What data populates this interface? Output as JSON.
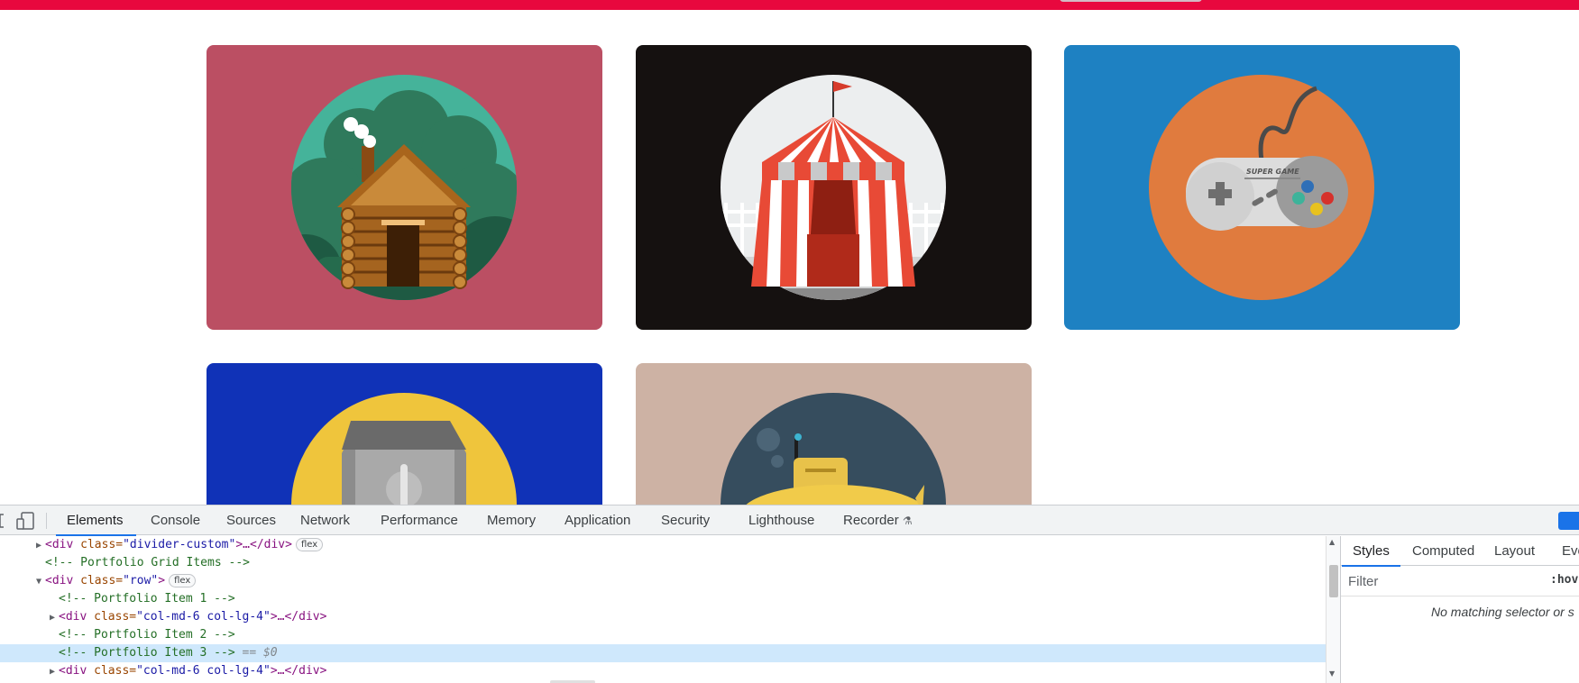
{
  "page": {
    "colors": {
      "topbar": "#e8083e",
      "card_cabin": "#bb4f63",
      "card_circus": "#151110",
      "card_game": "#1e81c2",
      "card_safe": "#1032b7",
      "card_submarine": "#cdb2a4"
    },
    "portfolio_items": [
      {
        "icon": "cabin-icon"
      },
      {
        "icon": "circus-tent-icon"
      },
      {
        "icon": "game-controller-icon",
        "controller_text": "SUPER GAME"
      },
      {
        "icon": "safe-icon"
      },
      {
        "icon": "submarine-icon"
      }
    ]
  },
  "devtools": {
    "tabs": [
      "Elements",
      "Console",
      "Sources",
      "Network",
      "Performance",
      "Memory",
      "Application",
      "Security",
      "Lighthouse",
      "Recorder"
    ],
    "active_tab": "Elements",
    "recorder_icon": "flask-icon",
    "dom_lines": [
      {
        "tag_open": "<div ",
        "attr": "class=",
        "val": "\"divider-custom\"",
        "rest": ">…</div>",
        "badge": "flex"
      },
      {
        "comment": "<!-- Portfolio Grid Items -->"
      },
      {
        "tag_open": "<div ",
        "attr": "class=",
        "val": "\"row\"",
        "rest": ">",
        "badge": "flex"
      },
      {
        "comment": "<!-- Portfolio Item 1 -->"
      },
      {
        "tag_open": "<div ",
        "attr": "class=",
        "val": "\"col-md-6 col-lg-4\"",
        "rest": ">…</div>"
      },
      {
        "comment": "<!-- Portfolio Item 2 -->"
      },
      {
        "comment": "<!-- Portfolio Item 3 -->",
        "marker": "== $0"
      },
      {
        "tag_open": "<div ",
        "attr": "class=",
        "val": "\"col-md-6 col-lg-4\"",
        "rest": ">…</div>"
      }
    ],
    "styles_panel": {
      "tabs": [
        "Styles",
        "Computed",
        "Layout",
        "Eve"
      ],
      "active_tab": "Styles",
      "filter_placeholder": "Filter",
      "hov_label": ":hov",
      "empty_message": "No matching selector or s"
    }
  }
}
